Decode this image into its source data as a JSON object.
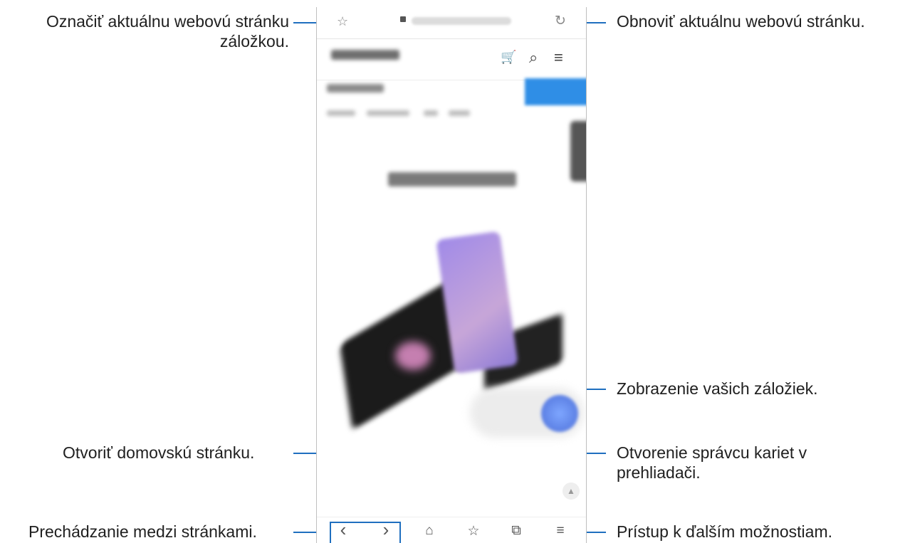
{
  "callouts": {
    "bookmark_page": "Označiť aktuálnu webovú stránku záložkou.",
    "refresh_page": "Obnoviť aktuálnu webovú stránku.",
    "view_bookmarks": "Zobrazenie vašich záložiek.",
    "open_home": "Otvoriť domovskú stránku.",
    "tab_manager_line1": "Otvorenie správcu kariet v",
    "tab_manager_line2": "prehliadači.",
    "navigate_pages": "Prechádzanie medzi stránkami.",
    "more_options": "Prístup k ďalším možnostiam."
  },
  "icons": {
    "bookmark": "☆",
    "reload": "↻",
    "cart": "🛒",
    "search": "⌕",
    "menu": "≡",
    "back": "‹",
    "forward": "›",
    "home": "⌂",
    "bookmarks_list": "☆",
    "tabs": "⧉",
    "more": "≡",
    "scroll_top": "▲"
  },
  "colors": {
    "connector": "#1f6fbf"
  }
}
